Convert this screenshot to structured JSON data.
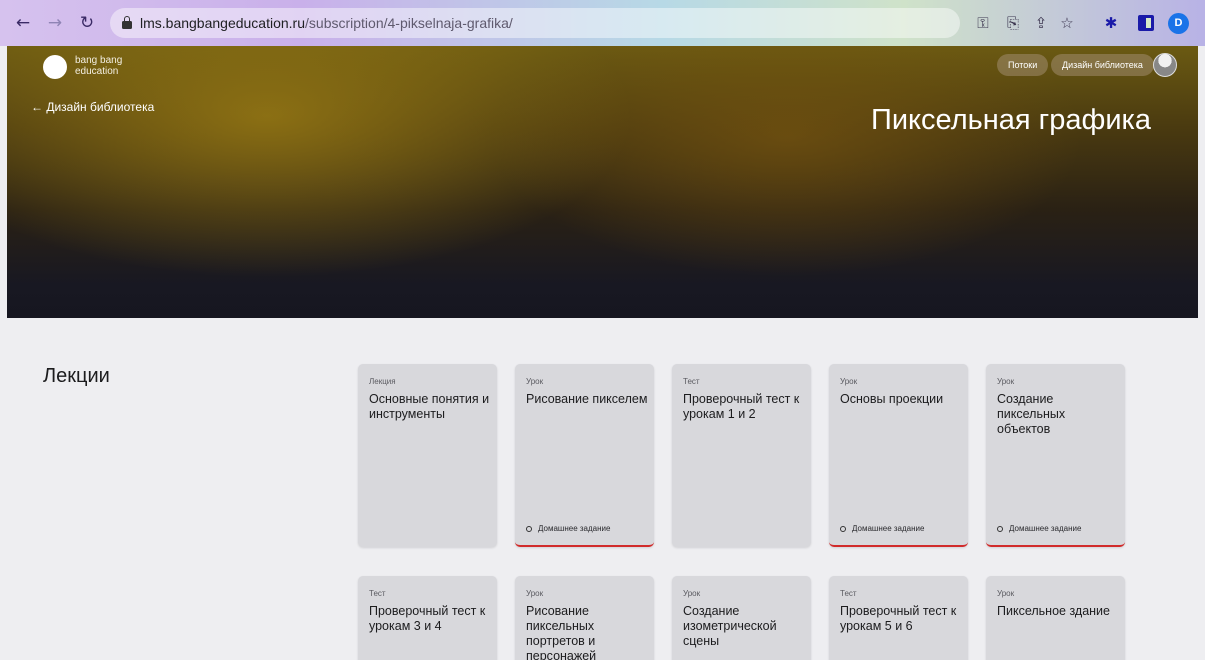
{
  "browser": {
    "url_host": "lms.bangbangeducation.ru",
    "url_path": "/subscription/4-pikselnaja-grafika/",
    "profile_initial": "D"
  },
  "header": {
    "logo_line1": "bang bang",
    "logo_line2": "education",
    "nav_streams": "Потоки",
    "nav_library": "Дизайн библиотека",
    "back_link": "← Дизайн библиотека",
    "title": "Пиксельная графика"
  },
  "lectures": {
    "section_title": "Лекции",
    "cards": [
      {
        "kind": "Лекция",
        "title": "Основные понятия и инструменты",
        "homework": ""
      },
      {
        "kind": "Урок",
        "title": "Рисование пикселем",
        "homework": "Домашнее задание"
      },
      {
        "kind": "Тест",
        "title": "Проверочный тест к урокам 1 и 2",
        "homework": ""
      },
      {
        "kind": "Урок",
        "title": "Основы проекции",
        "homework": "Домашнее задание"
      },
      {
        "kind": "Урок",
        "title": "Создание пиксельных объектов",
        "homework": "Домашнее задание"
      },
      {
        "kind": "Тест",
        "title": "Проверочный тест к урокам 3 и 4",
        "homework": ""
      },
      {
        "kind": "Урок",
        "title": "Рисование пиксельных портретов и персонажей",
        "homework": ""
      },
      {
        "kind": "Урок",
        "title": "Создание изометрической сцены",
        "homework": ""
      },
      {
        "kind": "Тест",
        "title": "Проверочный тест к урокам 5 и 6",
        "homework": ""
      },
      {
        "kind": "Урок",
        "title": "Пиксельное здание",
        "homework": ""
      }
    ]
  }
}
